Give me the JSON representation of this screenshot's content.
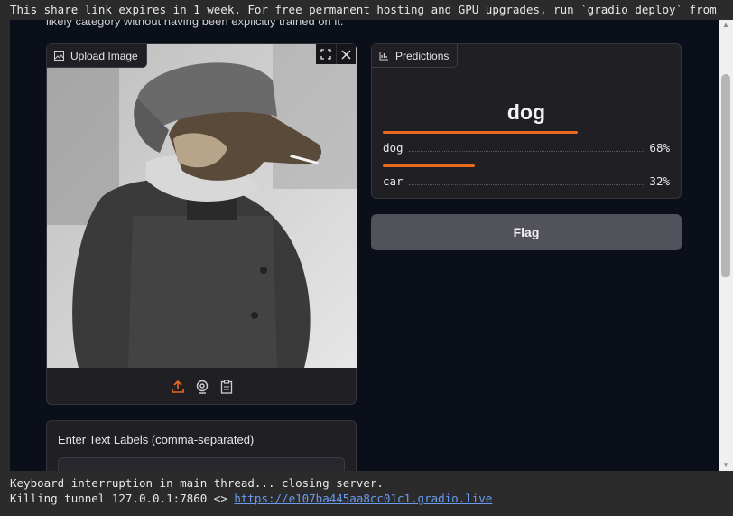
{
  "terminal": {
    "top_line": "This share link expires in 1 week. For free permanent hosting and GPU upgrades, run `gradio deploy` from",
    "bottom_line1": "Keyboard interruption in main thread... closing server.",
    "bottom_line2_prefix": "Killing tunnel 127.0.0.1:7860 <> ",
    "bottom_link": "https://e107ba445aa8cc01c1.gradio.live"
  },
  "app": {
    "description_fragment": "likely category without having been explicitly trained on it.",
    "image_input": {
      "label": "Upload Image",
      "icon": "image-icon",
      "controls": [
        "fullscreen-icon",
        "close-icon"
      ],
      "toolbar": [
        "upload-icon",
        "webcam-icon",
        "clipboard-icon"
      ]
    },
    "text_input": {
      "label": "Enter Text Labels (comma-separated)",
      "value": ""
    },
    "predictions": {
      "label": "Predictions",
      "top_label": "dog",
      "items": [
        {
          "label": "dog",
          "percent": "68%",
          "confidence": 0.68
        },
        {
          "label": "car",
          "percent": "32%",
          "confidence": 0.32
        }
      ]
    },
    "flag_button": "Flag"
  },
  "colors": {
    "accent": "#ea6a1e",
    "background": "#0b0f19",
    "panel": "#1f1f24",
    "link": "#6b9bf0"
  }
}
